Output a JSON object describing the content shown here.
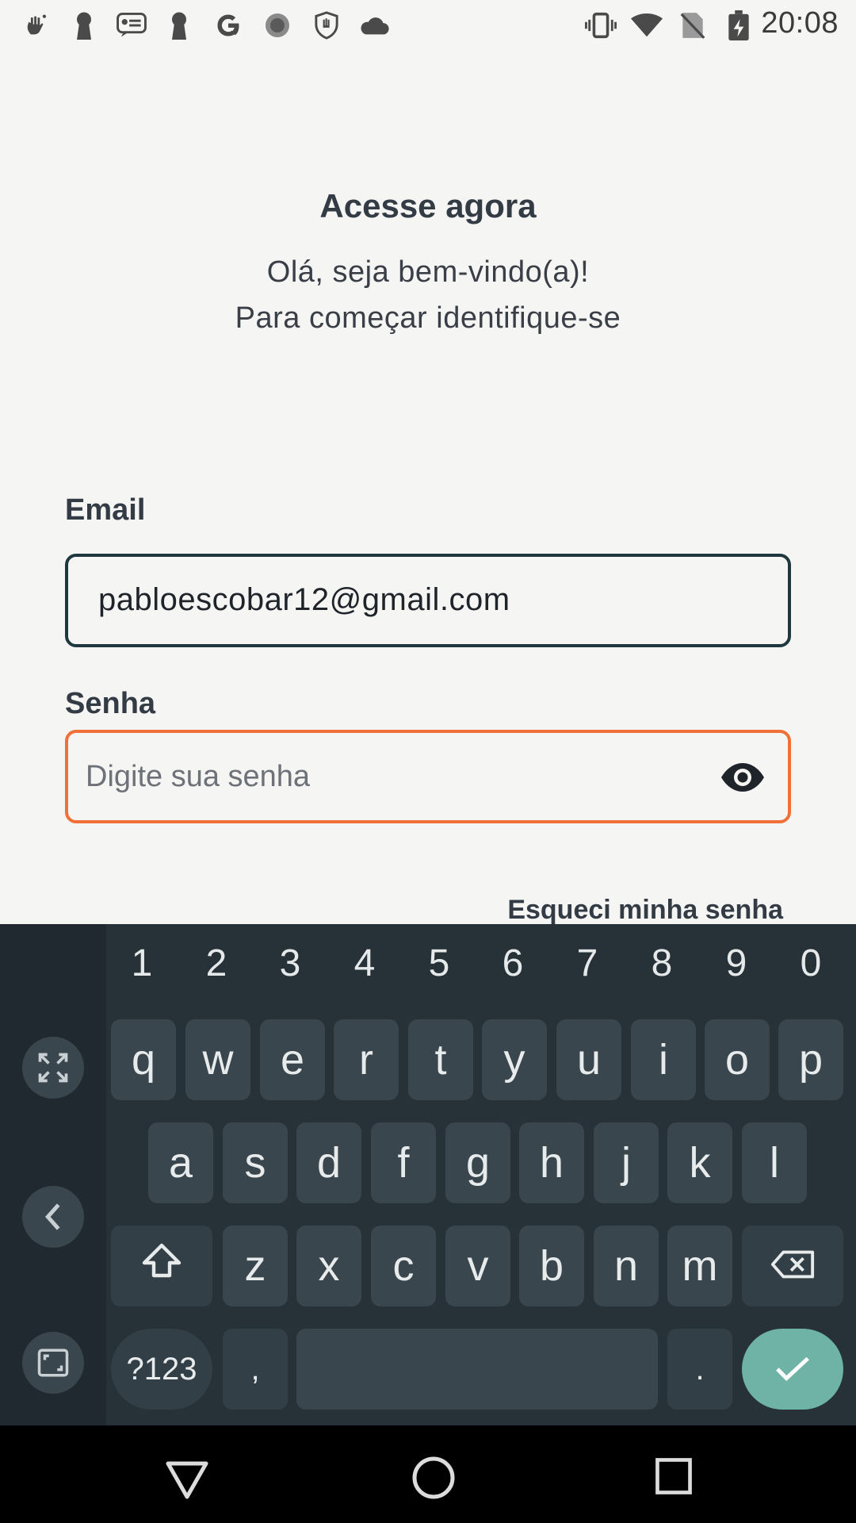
{
  "status_bar": {
    "time": "20:08",
    "left_icons": [
      "hand-sparkle-icon",
      "keyhole-icon",
      "chat-card-icon",
      "keyhole-icon",
      "google-icon",
      "record-icon",
      "shield-hand-icon",
      "cloud-icon"
    ],
    "right_icons": [
      "vibrate-icon",
      "wifi-icon",
      "no-sim-icon",
      "battery-charging-icon"
    ]
  },
  "header": {
    "title": "Acesse agora",
    "subtitle_line1": "Olá, seja bem-vindo(a)!",
    "subtitle_line2": "Para começar identifique-se"
  },
  "form": {
    "email_label": "Email",
    "email_value": "pabloescobar12@gmail.com",
    "password_label": "Senha",
    "password_placeholder": "Digite sua senha",
    "forgot_password": "Esqueci minha senha"
  },
  "keyboard": {
    "numbers": [
      "1",
      "2",
      "3",
      "4",
      "5",
      "6",
      "7",
      "8",
      "9",
      "0"
    ],
    "row1": [
      "q",
      "w",
      "e",
      "r",
      "t",
      "y",
      "u",
      "i",
      "o",
      "p"
    ],
    "row2": [
      "a",
      "s",
      "d",
      "f",
      "g",
      "h",
      "j",
      "k",
      "l"
    ],
    "row3": [
      "z",
      "x",
      "c",
      "v",
      "b",
      "n",
      "m"
    ],
    "symbols_key": "?123",
    "comma_key": ",",
    "period_key": "."
  },
  "colors": {
    "email_border": "#1f3840",
    "password_border_focus": "#f07038",
    "enter_key": "#6fb3a6",
    "keyboard_bg": "#263238"
  }
}
